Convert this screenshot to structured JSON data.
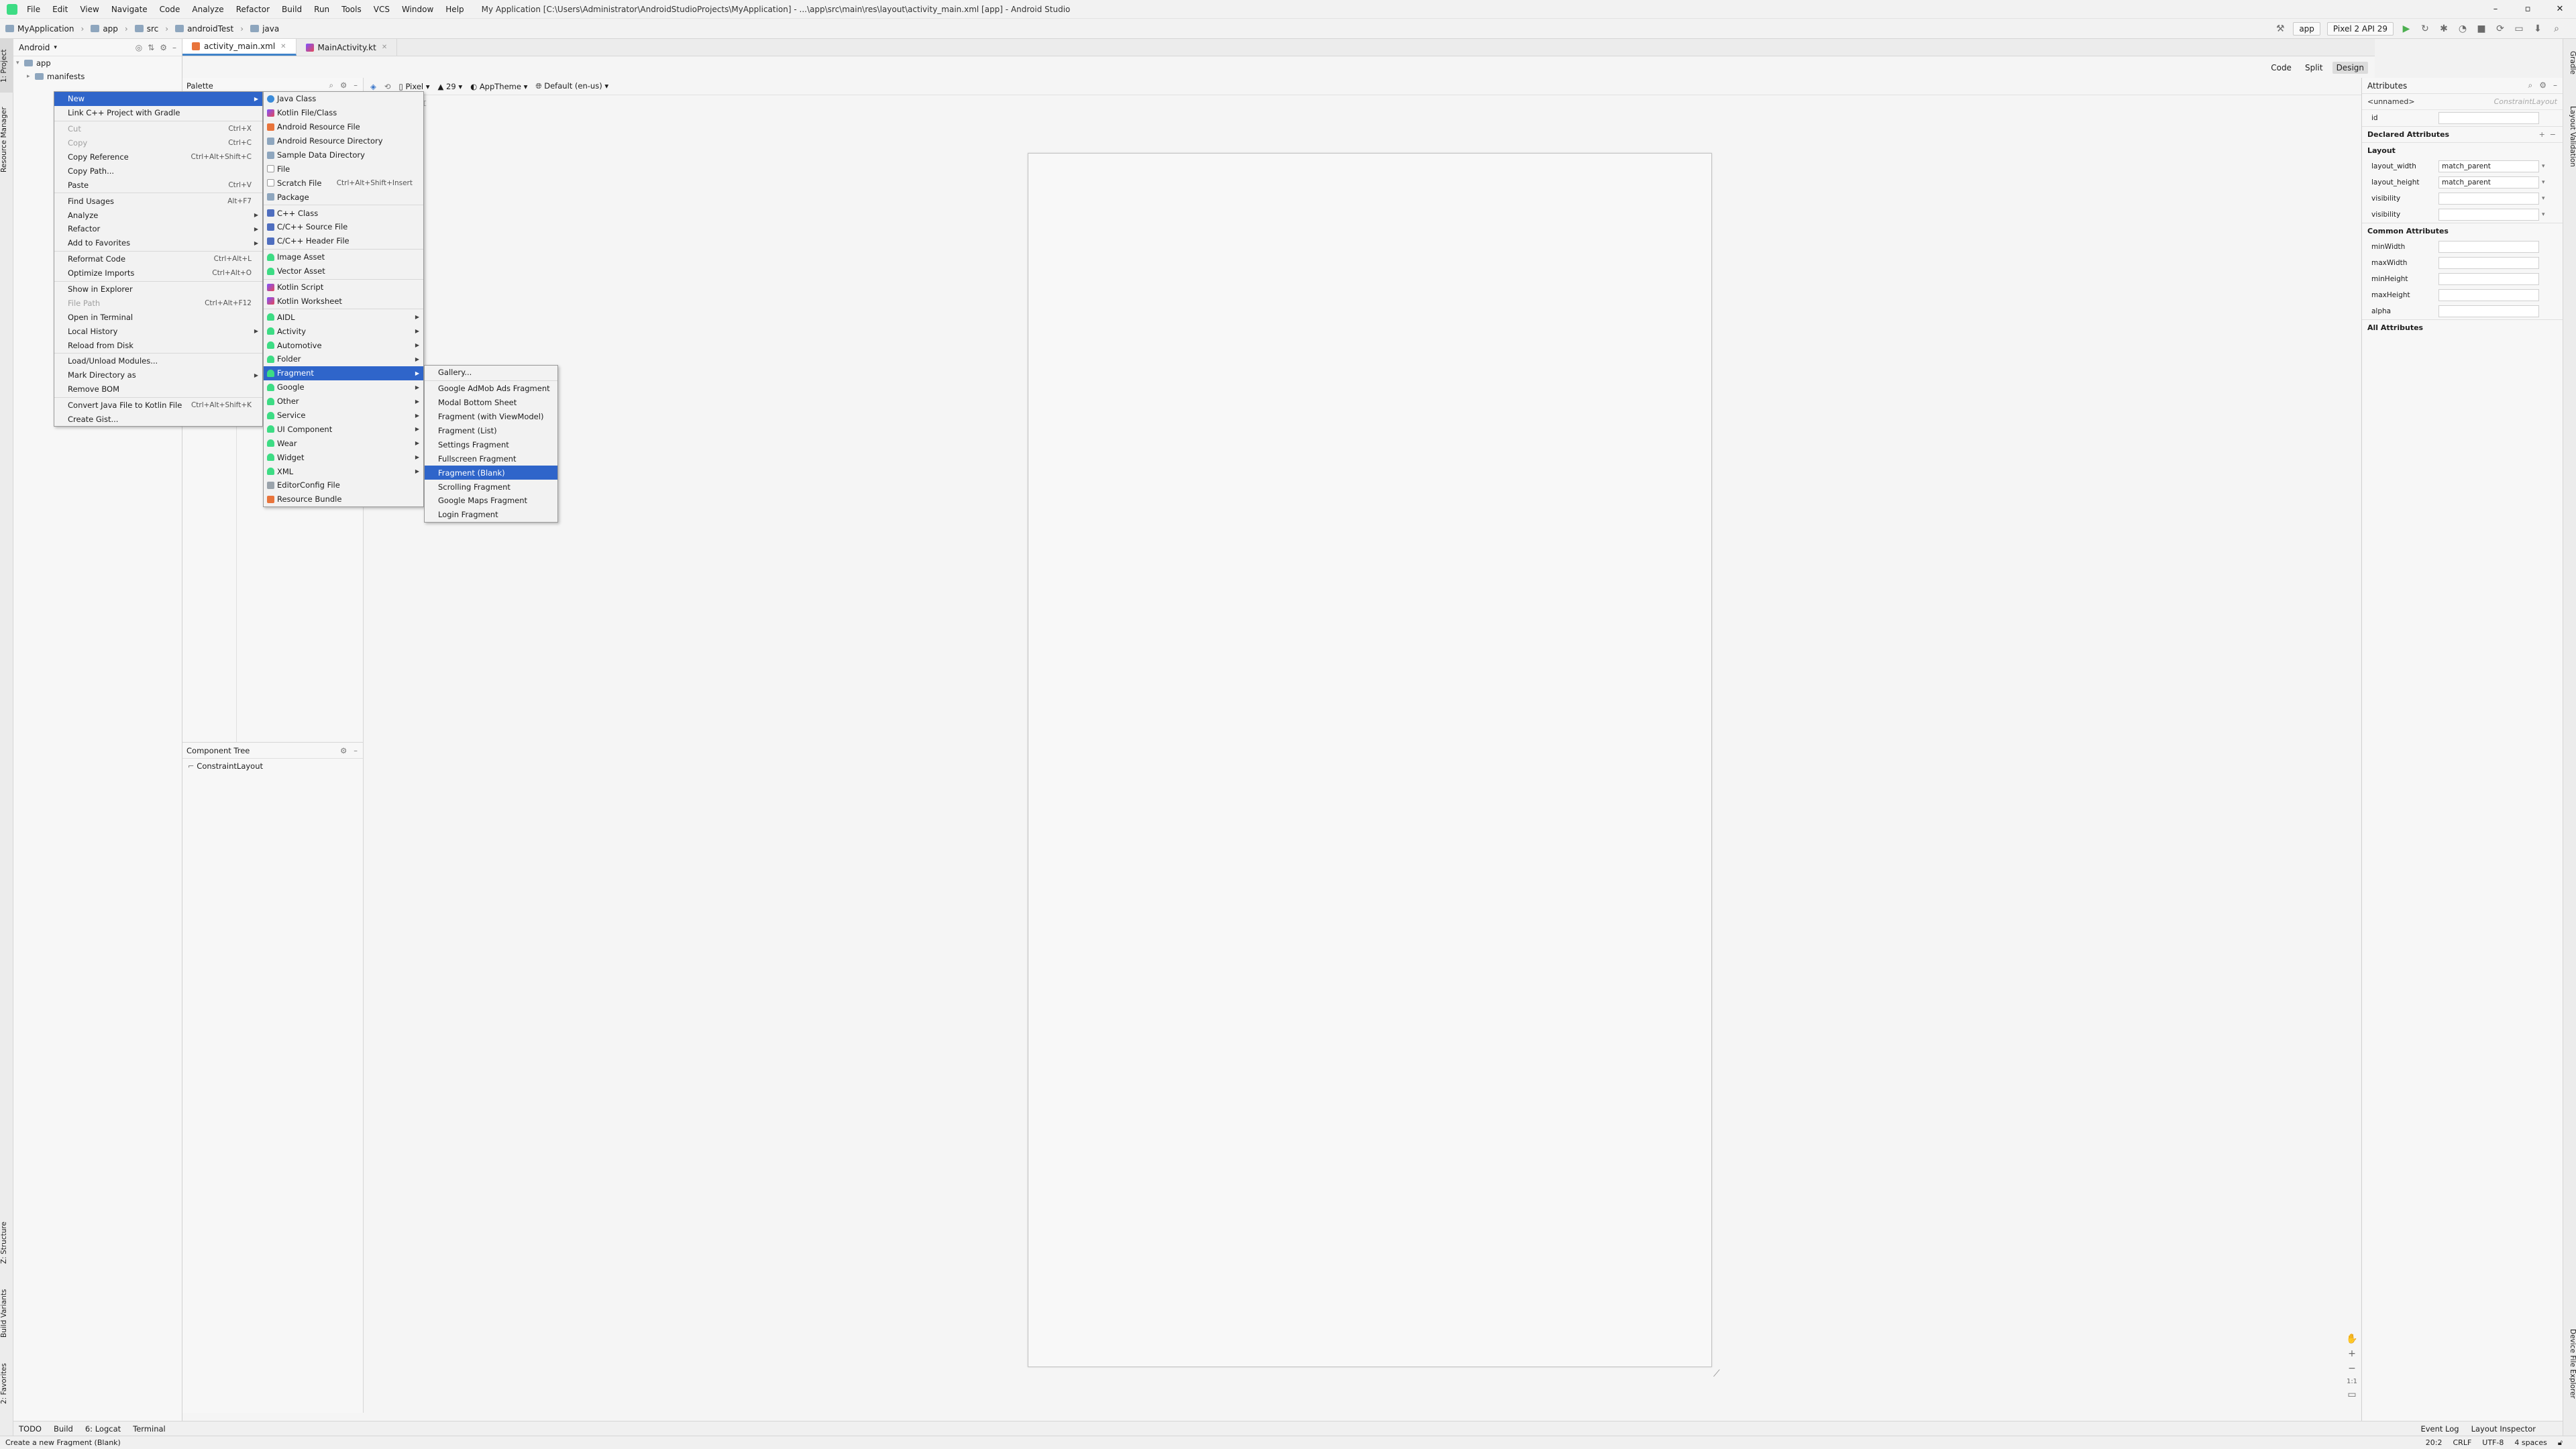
{
  "menubar": {
    "items": [
      "File",
      "Edit",
      "View",
      "Navigate",
      "Code",
      "Analyze",
      "Refactor",
      "Build",
      "Run",
      "Tools",
      "VCS",
      "Window",
      "Help"
    ],
    "title": "My Application [C:\\Users\\Administrator\\AndroidStudioProjects\\MyApplication] - ...\\app\\src\\main\\res\\layout\\activity_main.xml [app] - Android Studio"
  },
  "navbar": {
    "crumbs": [
      "MyApplication",
      "app",
      "src",
      "androidTest",
      "java"
    ],
    "run_config": "app",
    "device": "Pixel 2 API 29"
  },
  "side_tabs": {
    "left": [
      "1: Project",
      "Resource Manager",
      "Z: Structure",
      "Build Variants",
      "2: Favorites"
    ],
    "right": [
      "Gradle",
      "Layout Validation",
      "Device File Explorer"
    ]
  },
  "project": {
    "view": "Android",
    "tree": [
      {
        "label": "app",
        "depth": 0,
        "arrow": "▾"
      },
      {
        "label": "manifests",
        "depth": 1,
        "arrow": "▸"
      }
    ]
  },
  "editor": {
    "tabs": [
      {
        "label": "activity_main.xml",
        "active": true
      },
      {
        "label": "MainActivity.kt",
        "active": false
      }
    ],
    "view_modes": [
      "Code",
      "Split",
      "Design"
    ],
    "palette_title": "Palette",
    "component_tree_title": "Component Tree",
    "component_root": "ConstraintLayout",
    "design_toolbar": {
      "device": "Pixel",
      "api": "29",
      "theme": "AppTheme",
      "locale": "Default (en-us)"
    }
  },
  "attributes": {
    "title": "Attributes",
    "component": "<unnamed>",
    "component_type": "ConstraintLayout",
    "id_label": "id",
    "sections": {
      "declared": "Declared Attributes",
      "layout": "Layout",
      "common": "Common Attributes",
      "all": "All Attributes"
    },
    "layout_rows": [
      {
        "label": "layout_width",
        "value": "match_parent"
      },
      {
        "label": "layout_height",
        "value": "match_parent"
      },
      {
        "label": "visibility",
        "value": ""
      },
      {
        "label": "visibility",
        "value": ""
      }
    ],
    "common_rows": [
      "minWidth",
      "maxWidth",
      "minHeight",
      "maxHeight",
      "alpha"
    ]
  },
  "context_menu": [
    {
      "label": "New",
      "submenu": true,
      "selected": true
    },
    {
      "label": "Link C++ Project with Gradle"
    },
    {
      "divider": true
    },
    {
      "label": "Cut",
      "shortcut": "Ctrl+X",
      "disabled": true
    },
    {
      "label": "Copy",
      "shortcut": "Ctrl+C",
      "disabled": true
    },
    {
      "label": "Copy Reference",
      "shortcut": "Ctrl+Alt+Shift+C"
    },
    {
      "label": "Copy Path..."
    },
    {
      "label": "Paste",
      "shortcut": "Ctrl+V"
    },
    {
      "divider": true
    },
    {
      "label": "Find Usages",
      "shortcut": "Alt+F7"
    },
    {
      "label": "Analyze",
      "submenu": true
    },
    {
      "label": "Refactor",
      "submenu": true
    },
    {
      "label": "Add to Favorites",
      "submenu": true
    },
    {
      "divider": true
    },
    {
      "label": "Reformat Code",
      "shortcut": "Ctrl+Alt+L"
    },
    {
      "label": "Optimize Imports",
      "shortcut": "Ctrl+Alt+O"
    },
    {
      "divider": true
    },
    {
      "label": "Show in Explorer"
    },
    {
      "label": "File Path",
      "shortcut": "Ctrl+Alt+F12",
      "disabled": true
    },
    {
      "label": "Open in Terminal"
    },
    {
      "label": "Local History",
      "submenu": true
    },
    {
      "label": "Reload from Disk"
    },
    {
      "divider": true
    },
    {
      "label": "Load/Unload Modules..."
    },
    {
      "label": "Mark Directory as",
      "submenu": true
    },
    {
      "label": "Remove BOM"
    },
    {
      "divider": true
    },
    {
      "label": "Convert Java File to Kotlin File",
      "shortcut": "Ctrl+Alt+Shift+K"
    },
    {
      "label": "Create Gist..."
    }
  ],
  "new_menu": [
    {
      "label": "Java Class",
      "icon": "java"
    },
    {
      "label": "Kotlin File/Class",
      "icon": "kot"
    },
    {
      "label": "Android Resource File",
      "icon": "res"
    },
    {
      "label": "Android Resource Directory",
      "icon": "fold"
    },
    {
      "label": "Sample Data Directory",
      "icon": "fold"
    },
    {
      "label": "File",
      "icon": "doc"
    },
    {
      "label": "Scratch File",
      "icon": "doc",
      "shortcut": "Ctrl+Alt+Shift+Insert"
    },
    {
      "label": "Package",
      "icon": "fold"
    },
    {
      "divider": true
    },
    {
      "label": "C++ Class",
      "icon": "cpp"
    },
    {
      "label": "C/C++ Source File",
      "icon": "cpp"
    },
    {
      "label": "C/C++ Header File",
      "icon": "cpp"
    },
    {
      "divider": true
    },
    {
      "label": "Image Asset",
      "icon": "android"
    },
    {
      "label": "Vector Asset",
      "icon": "android"
    },
    {
      "divider": true
    },
    {
      "label": "Kotlin Script",
      "icon": "kot"
    },
    {
      "label": "Kotlin Worksheet",
      "icon": "kot"
    },
    {
      "divider": true
    },
    {
      "label": "AIDL",
      "icon": "android",
      "submenu": true
    },
    {
      "label": "Activity",
      "icon": "android",
      "submenu": true
    },
    {
      "label": "Automotive",
      "icon": "android",
      "submenu": true
    },
    {
      "label": "Folder",
      "icon": "android",
      "submenu": true
    },
    {
      "label": "Fragment",
      "icon": "android",
      "submenu": true,
      "selected": true
    },
    {
      "label": "Google",
      "icon": "android",
      "submenu": true
    },
    {
      "label": "Other",
      "icon": "android",
      "submenu": true
    },
    {
      "label": "Service",
      "icon": "android",
      "submenu": true
    },
    {
      "label": "UI Component",
      "icon": "android",
      "submenu": true
    },
    {
      "label": "Wear",
      "icon": "android",
      "submenu": true
    },
    {
      "label": "Widget",
      "icon": "android",
      "submenu": true
    },
    {
      "label": "XML",
      "icon": "android",
      "submenu": true
    },
    {
      "label": "EditorConfig File",
      "icon": "gray"
    },
    {
      "label": "Resource Bundle",
      "icon": "res"
    }
  ],
  "fragment_menu": [
    {
      "label": "Gallery..."
    },
    {
      "divider": true
    },
    {
      "label": "Google AdMob Ads Fragment"
    },
    {
      "label": "Modal Bottom Sheet"
    },
    {
      "label": "Fragment (with ViewModel)"
    },
    {
      "label": "Fragment (List)"
    },
    {
      "label": "Settings Fragment"
    },
    {
      "label": "Fullscreen Fragment"
    },
    {
      "label": "Fragment (Blank)",
      "selected": true
    },
    {
      "label": "Scrolling Fragment"
    },
    {
      "label": "Google Maps Fragment"
    },
    {
      "label": "Login Fragment"
    }
  ],
  "bottom_tools": [
    "TODO",
    "Build",
    "6: Logcat",
    "Terminal"
  ],
  "bottom_right_tools": [
    "Event Log",
    "Layout Inspector"
  ],
  "statusbar": {
    "message": "Create a new Fragment (Blank)",
    "position": "20:2",
    "line_sep": "CRLF",
    "encoding": "UTF-8",
    "indent": "4 spaces"
  }
}
